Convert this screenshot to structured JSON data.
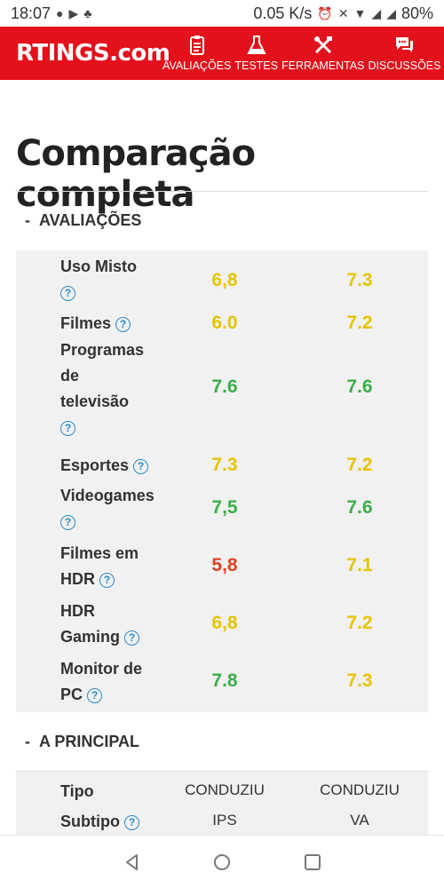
{
  "status": {
    "time": "18:07",
    "speed": "0.05 K/s",
    "battery": "80%"
  },
  "header": {
    "logo": "RTINGS.com",
    "nav": [
      {
        "label": "AVALIAÇÕES",
        "icon": "clipboard-icon"
      },
      {
        "label": "TESTES",
        "icon": "beaker-icon"
      },
      {
        "label": "FERRAMENTAS",
        "icon": "tools-icon"
      },
      {
        "label": "DISCUSSÕES",
        "icon": "chat-icon"
      }
    ]
  },
  "page": {
    "title": "Comparação completa"
  },
  "reviews": {
    "heading_toggle": "-",
    "heading": "AVALIAÇÕES",
    "rows": [
      {
        "label": "Uso Misto",
        "a": "6,8",
        "a_color": "yellow",
        "b": "7.3",
        "b_color": "yellow"
      },
      {
        "label": "Filmes",
        "a": "6.0",
        "a_color": "yellow",
        "b": "7.2",
        "b_color": "yellow"
      },
      {
        "label": "Programas de televisão",
        "a": "7.6",
        "a_color": "green",
        "b": "7.6",
        "b_color": "green"
      },
      {
        "label": "Esportes",
        "a": "7.3",
        "a_color": "yellow",
        "b": "7.2",
        "b_color": "yellow"
      },
      {
        "label": "Videogames",
        "a": "7,5",
        "a_color": "green",
        "b": "7.6",
        "b_color": "green"
      },
      {
        "label": "Filmes em HDR",
        "a": "5,8",
        "a_color": "red",
        "b": "7.1",
        "b_color": "yellow"
      },
      {
        "label": "HDR Gaming",
        "a": "6,8",
        "a_color": "yellow",
        "b": "7.2",
        "b_color": "yellow"
      },
      {
        "label": "Monitor de PC",
        "a": "7.8",
        "a_color": "green",
        "b": "7.3",
        "b_color": "yellow"
      }
    ],
    "help_glyph": "?"
  },
  "main": {
    "heading_toggle": "-",
    "heading": "A PRINCIPAL",
    "rows": [
      {
        "label": "Tipo",
        "a": "CONDUZIU",
        "b": "CONDUZIU"
      },
      {
        "label": "Subtipo",
        "a": "IPS",
        "b": "VA"
      }
    ]
  },
  "colors": {
    "brand": "#e3111b",
    "yellow": "#e6c400",
    "green": "#3cae49",
    "red": "#e0431f",
    "help": "#2a8bd0"
  }
}
